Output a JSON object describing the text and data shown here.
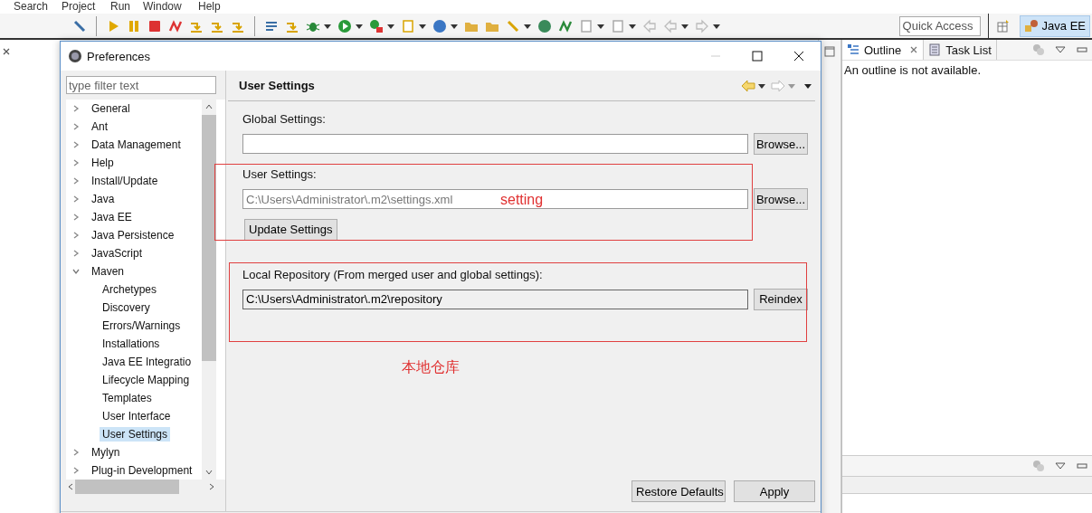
{
  "menu_bar": [
    "Search",
    "Project",
    "Run",
    "Window",
    "Help"
  ],
  "quick_access": {
    "placeholder": "Quick Access"
  },
  "perspective": {
    "label": "Java EE",
    "selected": true
  },
  "outline_panel": {
    "tabs": [
      {
        "label": "Outline",
        "selected": true
      },
      {
        "label": "Task List",
        "selected": false
      }
    ],
    "message": "An outline is not available."
  },
  "dialog": {
    "title": "Preferences",
    "filter": {
      "placeholder": "type filter text"
    },
    "tree": [
      {
        "label": "General",
        "expanded": false,
        "selected": false
      },
      {
        "label": "Ant",
        "expanded": false,
        "selected": false
      },
      {
        "label": "Data Management",
        "expanded": false,
        "selected": false
      },
      {
        "label": "Help",
        "expanded": false,
        "selected": false
      },
      {
        "label": "Install/Update",
        "expanded": false,
        "selected": false
      },
      {
        "label": "Java",
        "expanded": false,
        "selected": false
      },
      {
        "label": "Java EE",
        "expanded": false,
        "selected": false
      },
      {
        "label": "Java Persistence",
        "expanded": false,
        "selected": false
      },
      {
        "label": "JavaScript",
        "expanded": false,
        "selected": false
      },
      {
        "label": "Maven",
        "expanded": true,
        "selected": false,
        "children": [
          {
            "label": "Archetypes",
            "selected": false
          },
          {
            "label": "Discovery",
            "selected": false
          },
          {
            "label": "Errors/Warnings",
            "selected": false
          },
          {
            "label": "Installations",
            "selected": false
          },
          {
            "label": "Java EE Integratio",
            "selected": false
          },
          {
            "label": "Lifecycle Mapping",
            "selected": false
          },
          {
            "label": "Templates",
            "selected": false
          },
          {
            "label": "User Interface",
            "selected": false
          },
          {
            "label": "User Settings",
            "selected": true
          }
        ]
      },
      {
        "label": "Mylyn",
        "expanded": false,
        "selected": false
      },
      {
        "label": "Plug-in Development",
        "expanded": false,
        "selected": false
      }
    ],
    "page_title": "User Settings",
    "global_settings": {
      "label": "Global Settings:",
      "button": "Browse..."
    },
    "user_settings": {
      "label": "User Settings:",
      "placeholder": "C:\\Users\\Administrator\\.m2\\settings.xml",
      "button": "Browse...",
      "update_button": "Update Settings"
    },
    "local_repository": {
      "label": "Local Repository (From merged user and global settings):",
      "value": "C:\\Users\\Administrator\\.m2\\repository",
      "button": "Reindex"
    },
    "buttons": [
      "Restore Defaults",
      "Apply"
    ]
  },
  "annotations": [
    {
      "text": "setting"
    },
    {
      "text": "本地仓库"
    }
  ]
}
